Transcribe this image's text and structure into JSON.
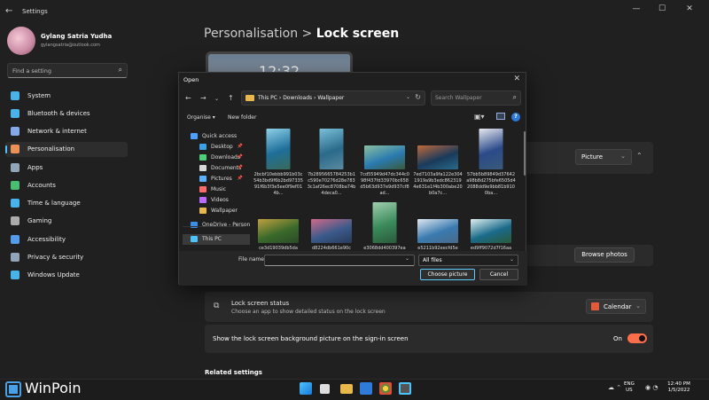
{
  "window": {
    "title": "Settings",
    "back": "←",
    "minimize": "—",
    "maximize": "☐",
    "close": "✕"
  },
  "user": {
    "name": "Gylang Satria Yudha",
    "email": "gylangsatria@outlook.com"
  },
  "search": {
    "placeholder": "Find a setting"
  },
  "nav": [
    {
      "label": "System",
      "icon": "system-icon",
      "color": "#4cc2ff"
    },
    {
      "label": "Bluetooth & devices",
      "icon": "bluetooth-icon",
      "color": "#4cc2ff"
    },
    {
      "label": "Network & internet",
      "icon": "network-icon",
      "color": "#8fb8ff"
    },
    {
      "label": "Personalisation",
      "icon": "brush-icon",
      "color": "#ff9b5e"
    },
    {
      "label": "Apps",
      "icon": "apps-icon",
      "color": "#9fb3c8"
    },
    {
      "label": "Accounts",
      "icon": "accounts-icon",
      "color": "#4ccf7a"
    },
    {
      "label": "Time & language",
      "icon": "globe-icon",
      "color": "#4cc2ff"
    },
    {
      "label": "Gaming",
      "icon": "gaming-icon",
      "color": "#bbbbbb"
    },
    {
      "label": "Accessibility",
      "icon": "accessibility-icon",
      "color": "#5aa9ff"
    },
    {
      "label": "Privacy & security",
      "icon": "shield-icon",
      "color": "#9fb3c8"
    },
    {
      "label": "Windows Update",
      "icon": "update-icon",
      "color": "#4cc2ff"
    }
  ],
  "page": {
    "breadcrumb_parent": "Personalisation",
    "breadcrumb_sep": ">",
    "title": "Lock screen",
    "preview_time": "12:32"
  },
  "settings": {
    "picture_select": "Picture",
    "browse_label": "Browse photos",
    "status_title": "Lock screen status",
    "status_sub": "Choose an app to show detailed status on the lock screen",
    "status_value": "Calendar",
    "signin_label": "Show the lock screen background picture on the sign-in screen",
    "signin_state": "On",
    "related": "Related settings"
  },
  "dialog": {
    "title": "Open",
    "close": "✕",
    "crumbs": "This PC  ›  Downloads  ›  Wallpaper",
    "search_placeholder": "Search Wallpaper",
    "organise": "Organise ▾",
    "new_folder": "New folder",
    "help": "?",
    "nav": [
      {
        "label": "Quick access",
        "color": "#4ca0ff",
        "pin": ""
      },
      {
        "label": "Desktop",
        "color": "#3aa0e8",
        "pin": "📌"
      },
      {
        "label": "Downloads",
        "color": "#4ccf7a",
        "pin": "📌"
      },
      {
        "label": "Documents",
        "color": "#d8d8d8",
        "pin": "📌"
      },
      {
        "label": "Pictures",
        "color": "#5ab0ff",
        "pin": "📌"
      },
      {
        "label": "Music",
        "color": "#ff6a6a",
        "pin": ""
      },
      {
        "label": "Videos",
        "color": "#b96aff",
        "pin": ""
      },
      {
        "label": "Wallpaper",
        "color": "#e8b84a",
        "pin": ""
      },
      {
        "label": "OneDrive - Person",
        "color": "#3a8ee8",
        "pin": ""
      },
      {
        "label": "This PC",
        "color": "#4cc2ff",
        "pin": ""
      }
    ],
    "files": [
      {
        "name": "2bcbf10ebbb991b03c54b3bd9f6b2bd9733591f6b3f3e5ee0f9ef014b...",
        "colors": [
          "#1e6f9a",
          "#8fd0e8",
          "#3a6a5a"
        ],
        "portrait": true
      },
      {
        "name": "7b2895665784253b1c590e70276d28e7833c1af26ec8708ba74b4deca0...",
        "colors": [
          "#2a6a8a",
          "#7ac0d8",
          "#5a8aa0"
        ],
        "portrait": true
      },
      {
        "name": "7cd55949d47dc344c098f437fd33970bc658d5b63d937e9d937cf8ad...",
        "colors": [
          "#2a7ab0",
          "#8ac0a0",
          "#3a5a3a"
        ],
        "portrait": false
      },
      {
        "name": "7ed7103a9fa122e3041919a9b3edc8623194e631e1f4b300abe20b0a7c...",
        "colors": [
          "#1a3a5a",
          "#c06a3a",
          "#2a6a8a"
        ],
        "portrait": false
      },
      {
        "name": "57bb5b89849d37642a98b8d275bfe6505d42088dd9e9bb81b9100ba...",
        "colors": [
          "#2a4a8a",
          "#e8e8f0",
          "#3a5a7a"
        ],
        "portrait": true
      },
      {
        "name": "ce3d19039db5da",
        "colors": [
          "#3a6a2a",
          "#c0a040",
          "#2a4a2a"
        ],
        "portrait": false
      },
      {
        "name": "d8224db661e90c",
        "colors": [
          "#3a5a8a",
          "#d06a8a",
          "#2a3a5a"
        ],
        "portrait": false
      },
      {
        "name": "e3068dd400397ea",
        "colors": [
          "#3a8a5a",
          "#a0d0b0",
          "#2a5a3a"
        ],
        "portrait": true
      },
      {
        "name": "e5211b92eecfd5e",
        "colors": [
          "#3a7ab0",
          "#e0e8f0",
          "#4a6a8a"
        ],
        "portrait": false
      },
      {
        "name": "ed9ff9072d7f16aa",
        "colors": [
          "#1a6a8a",
          "#e0f0f0",
          "#2a5a3a"
        ],
        "portrait": false
      }
    ],
    "filename_label": "File name:",
    "filename_value": "",
    "filetype": "All files",
    "choose": "Choose picture",
    "cancel": "Cancel"
  },
  "taskbar": {
    "brand": "WinPoin",
    "lang": "ENG\nUS",
    "time": "12:40 PM",
    "date": "1/5/2022"
  }
}
